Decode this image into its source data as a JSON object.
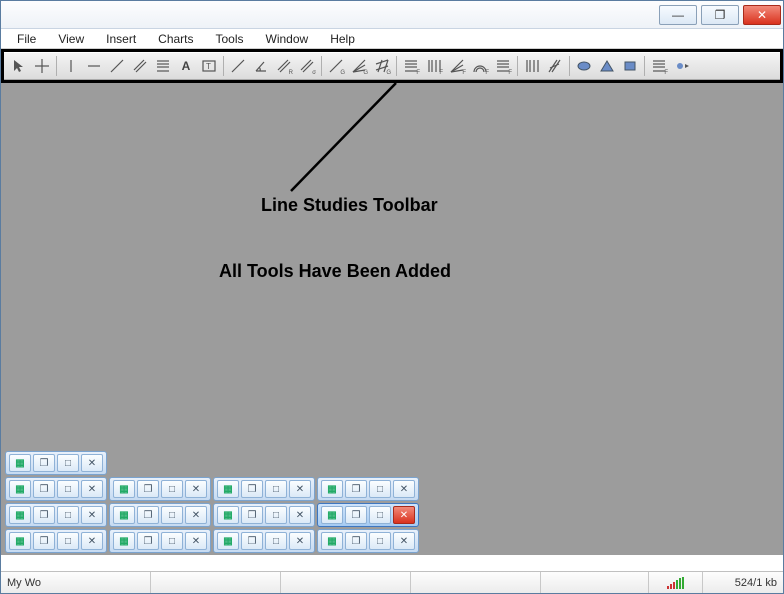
{
  "window": {
    "controls": {
      "min": "—",
      "max": "❐",
      "close": "✕"
    }
  },
  "menu": {
    "file": "File",
    "view": "View",
    "insert": "Insert",
    "charts": "Charts",
    "tools": "Tools",
    "window": "Window",
    "help": "Help"
  },
  "toolbar_icons": [
    {
      "name": "cursor-icon",
      "type": "cursor"
    },
    {
      "name": "crosshair-icon",
      "type": "crosshair"
    },
    {
      "name": "sep"
    },
    {
      "name": "vertical-line-icon",
      "type": "vline"
    },
    {
      "name": "horizontal-line-icon",
      "type": "hline"
    },
    {
      "name": "trendline-icon",
      "type": "diag"
    },
    {
      "name": "equidistant-channel-icon",
      "type": "channel"
    },
    {
      "name": "fibo-retracement-icon",
      "type": "fiboret"
    },
    {
      "name": "text-icon",
      "type": "glyph",
      "glyph": "A"
    },
    {
      "name": "text-label-icon",
      "type": "textbox"
    },
    {
      "name": "sep"
    },
    {
      "name": "trend-by-angle-icon",
      "type": "diag",
      "sub": ""
    },
    {
      "name": "angle-icon",
      "type": "angle",
      "sub": ""
    },
    {
      "name": "linear-regression-icon",
      "type": "channel",
      "sub": "R"
    },
    {
      "name": "stddev-channel-icon",
      "type": "channel",
      "sub": "σ"
    },
    {
      "name": "sep"
    },
    {
      "name": "gann-line-icon",
      "type": "diag",
      "sub": "G"
    },
    {
      "name": "gann-fan-icon",
      "type": "fan",
      "sub": "G"
    },
    {
      "name": "gann-grid-icon",
      "type": "grid",
      "sub": "G"
    },
    {
      "name": "sep"
    },
    {
      "name": "fibo-channel-icon",
      "type": "fiboret",
      "sub": "F"
    },
    {
      "name": "fibo-timezones-icon",
      "type": "vbars",
      "sub": "F"
    },
    {
      "name": "fibo-fan-icon",
      "type": "fan",
      "sub": "F"
    },
    {
      "name": "fibo-arcs-icon",
      "type": "arcs",
      "sub": "F"
    },
    {
      "name": "fibo-expansion-icon",
      "type": "fiboret",
      "sub": "F"
    },
    {
      "name": "sep"
    },
    {
      "name": "cycle-lines-icon",
      "type": "vbars"
    },
    {
      "name": "andrews-pitchfork-icon",
      "type": "pitchfork"
    },
    {
      "name": "sep"
    },
    {
      "name": "ellipse-icon",
      "type": "ellipse"
    },
    {
      "name": "triangle-icon",
      "type": "triangle"
    },
    {
      "name": "rectangle-icon",
      "type": "rect"
    },
    {
      "name": "sep"
    },
    {
      "name": "fibo-tool-icon",
      "type": "fiboret",
      "sub": "F"
    },
    {
      "name": "arrows-icon",
      "type": "arrowdd"
    }
  ],
  "workspace": {
    "caption1": "Line Studies Toolbar",
    "caption2": "All Tools Have Been Added"
  },
  "mdi": {
    "rows": [
      [
        false
      ],
      [
        false,
        false,
        false,
        false
      ],
      [
        false,
        false,
        false,
        true
      ],
      [
        false,
        false,
        false,
        false
      ]
    ],
    "btn_restore": "❐",
    "btn_max": "□",
    "btn_close": "✕",
    "icon": "▦"
  },
  "status": {
    "left": "My Wo",
    "kb": "524/1 kb"
  }
}
